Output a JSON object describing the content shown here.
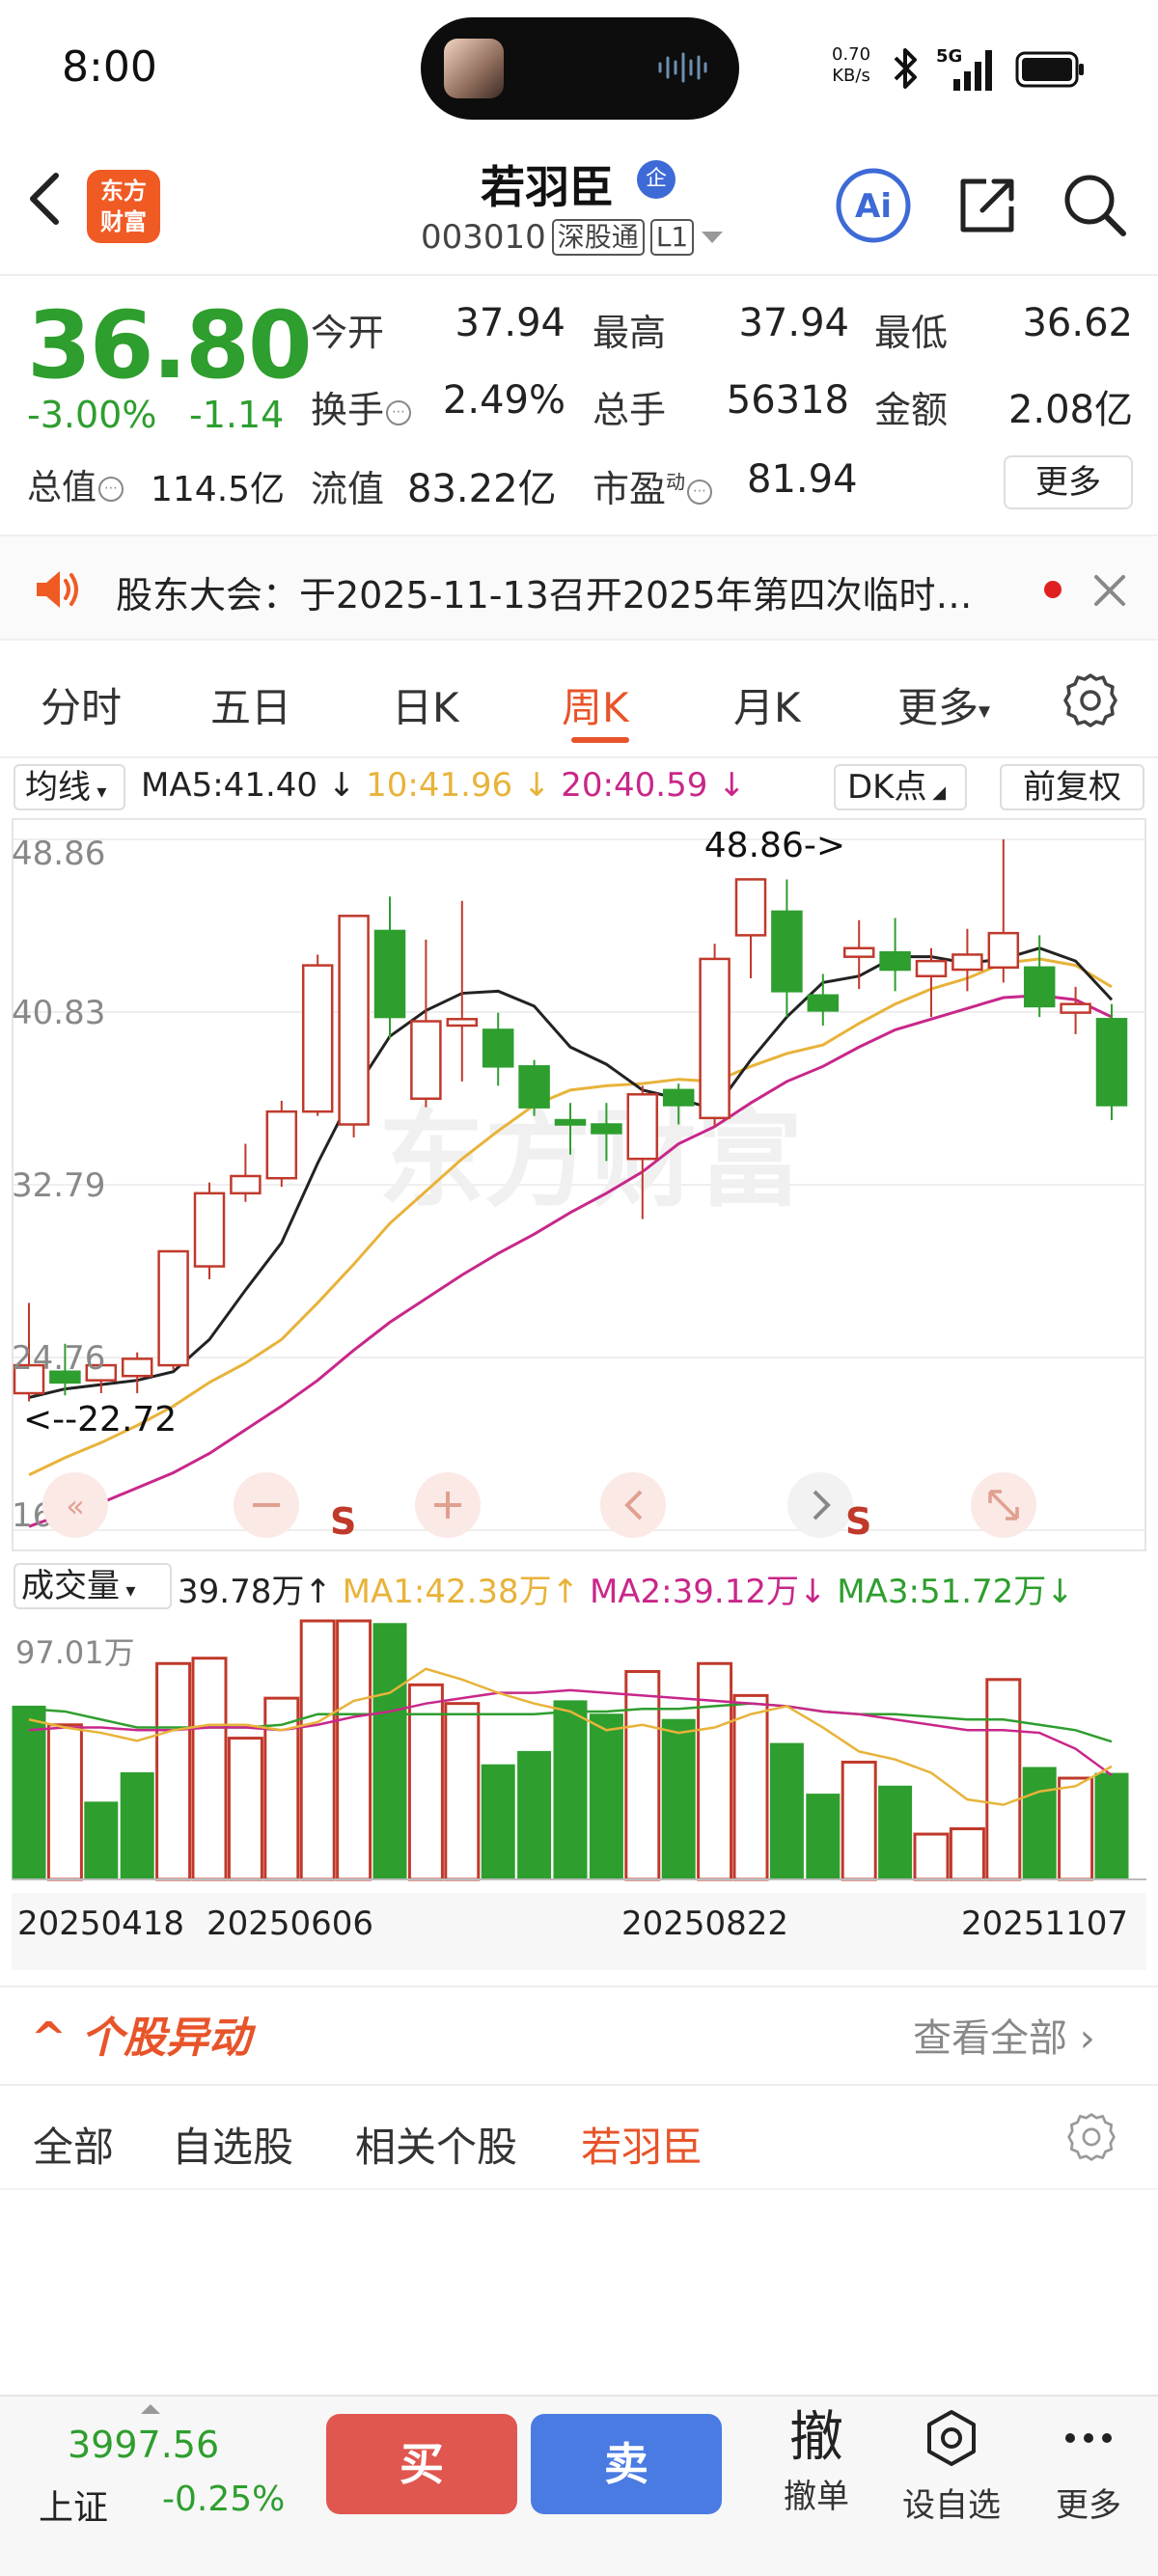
{
  "status_bar": {
    "time": "8:00",
    "net_speed_value": "0.70",
    "net_speed_unit": "KB/s",
    "network": "5G"
  },
  "header": {
    "logo_line1": "东方",
    "logo_line2": "财富",
    "stock_name": "若羽臣",
    "badge": "企",
    "code": "003010",
    "tag1": "深股通",
    "tag2": "L1"
  },
  "quote": {
    "price": "36.80",
    "change_pct": "-3.00%",
    "change_amt": "-1.14",
    "rows": [
      [
        {
          "label": "今开",
          "value": "37.94"
        },
        {
          "label": "最高",
          "value": "37.94"
        },
        {
          "label": "最低",
          "value": "36.62"
        }
      ],
      [
        {
          "label": "换手",
          "value": "2.49%"
        },
        {
          "label": "总手",
          "value": "56318"
        },
        {
          "label": "金额",
          "value": "2.08亿"
        }
      ]
    ],
    "total_mv_label": "总值",
    "total_mv": "114.5亿",
    "float_mv_label": "流值",
    "float_mv": "83.22亿",
    "pe_label": "市盈",
    "pe_sup": "动",
    "pe": "81.94",
    "more": "更多"
  },
  "notice": {
    "text": "股东大会：于2025-11-13召开2025年第四次临时…"
  },
  "tabs": {
    "items": [
      "分时",
      "五日",
      "日K",
      "周K",
      "月K",
      "更多"
    ],
    "active": "周K"
  },
  "kline_legend": {
    "dropdown": "均线",
    "ma5": "MA5:41.40",
    "ma10": "10:41.96",
    "ma20": "20:40.59",
    "dk": "DK点",
    "adjust": "前复权",
    "colors": {
      "ma5": "#222222",
      "ma10": "#e8b33a",
      "ma20": "#c8278a",
      "up": "#c0392b",
      "down": "#2e9e2e"
    }
  },
  "volume_legend": {
    "dropdown": "成交量",
    "vol": "39.78万",
    "ma1": "MA1:42.38万",
    "ma2": "MA2:39.12万",
    "ma3": "MA3:51.72万"
  },
  "chart_data": [
    {
      "type": "candlestick",
      "period": "weekly",
      "y_ticks": [
        "48.86",
        "40.83",
        "32.79",
        "24.76",
        "16.73"
      ],
      "ylim": [
        16.73,
        48.86
      ],
      "annotations": {
        "max_label": "48.86->",
        "min_label": "<--22.72"
      },
      "markers": [
        "S",
        "S"
      ],
      "watermark": "东方财富",
      "candles": [
        {
          "o": 23.1,
          "h": 27.3,
          "l": 22.72,
          "c": 24.4
        },
        {
          "o": 24.1,
          "h": 25.4,
          "l": 23.0,
          "c": 23.6
        },
        {
          "o": 23.7,
          "h": 24.6,
          "l": 23.1,
          "c": 24.4
        },
        {
          "o": 23.9,
          "h": 25.0,
          "l": 23.1,
          "c": 24.7
        },
        {
          "o": 24.4,
          "h": 29.7,
          "l": 24.2,
          "c": 29.7
        },
        {
          "o": 29.0,
          "h": 32.9,
          "l": 28.4,
          "c": 32.4
        },
        {
          "o": 32.4,
          "h": 34.7,
          "l": 32.0,
          "c": 33.2
        },
        {
          "o": 33.1,
          "h": 36.7,
          "l": 32.7,
          "c": 36.2
        },
        {
          "o": 36.2,
          "h": 43.5,
          "l": 36.0,
          "c": 43.0
        },
        {
          "o": 35.6,
          "h": 45.3,
          "l": 35.0,
          "c": 45.3
        },
        {
          "o": 44.6,
          "h": 46.2,
          "l": 39.6,
          "c": 40.6
        },
        {
          "o": 36.8,
          "h": 44.2,
          "l": 36.4,
          "c": 40.4
        },
        {
          "o": 40.2,
          "h": 46.0,
          "l": 37.6,
          "c": 40.5
        },
        {
          "o": 40.0,
          "h": 40.8,
          "l": 37.4,
          "c": 38.3
        },
        {
          "o": 38.3,
          "h": 38.6,
          "l": 36.0,
          "c": 36.4
        },
        {
          "o": 35.8,
          "h": 36.6,
          "l": 34.2,
          "c": 35.6
        },
        {
          "o": 35.6,
          "h": 36.6,
          "l": 33.9,
          "c": 35.2
        },
        {
          "o": 34.0,
          "h": 37.4,
          "l": 31.2,
          "c": 37.0
        },
        {
          "o": 37.2,
          "h": 37.5,
          "l": 35.6,
          "c": 36.5
        },
        {
          "o": 35.9,
          "h": 44.0,
          "l": 35.5,
          "c": 43.3
        },
        {
          "o": 44.4,
          "h": 46.9,
          "l": 42.4,
          "c": 47.0
        },
        {
          "o": 45.5,
          "h": 47.0,
          "l": 40.6,
          "c": 41.8
        },
        {
          "o": 41.6,
          "h": 42.6,
          "l": 40.2,
          "c": 40.9
        },
        {
          "o": 43.4,
          "h": 45.1,
          "l": 41.9,
          "c": 43.8
        },
        {
          "o": 43.6,
          "h": 45.2,
          "l": 41.8,
          "c": 42.8
        },
        {
          "o": 42.5,
          "h": 43.8,
          "l": 40.6,
          "c": 43.2
        },
        {
          "o": 42.8,
          "h": 44.7,
          "l": 41.8,
          "c": 43.5
        },
        {
          "o": 42.9,
          "h": 48.86,
          "l": 42.2,
          "c": 44.5
        },
        {
          "o": 42.9,
          "h": 44.4,
          "l": 40.6,
          "c": 41.1
        },
        {
          "o": 40.8,
          "h": 42.0,
          "l": 39.8,
          "c": 41.2
        },
        {
          "o": 40.5,
          "h": 41.2,
          "l": 35.8,
          "c": 36.5
        }
      ],
      "ma5": [
        22.9,
        23.3,
        23.5,
        23.7,
        24.1,
        25.6,
        27.9,
        30.1,
        33.8,
        37.1,
        39.7,
        40.9,
        41.7,
        41.8,
        41.1,
        39.2,
        38.4,
        37.2,
        36.8,
        36.3,
        38.6,
        40.6,
        42.2,
        42.5,
        43.4,
        43.4,
        43.1,
        43.3,
        43.8,
        43.2,
        41.4
      ],
      "ma10": [
        19.3,
        20.1,
        20.8,
        21.6,
        22.5,
        23.6,
        24.5,
        25.6,
        27.3,
        29.1,
        31.0,
        32.5,
        34.0,
        35.3,
        36.5,
        37.2,
        37.4,
        37.5,
        37.7,
        37.6,
        38.3,
        38.9,
        39.3,
        40.3,
        41.2,
        41.9,
        42.4,
        43.1,
        43.3,
        43.0,
        42.0
      ],
      "ma20": [
        16.9,
        17.5,
        18.0,
        18.7,
        19.4,
        20.3,
        21.4,
        22.5,
        23.7,
        25.1,
        26.4,
        27.5,
        28.6,
        29.6,
        30.5,
        31.5,
        32.4,
        33.4,
        34.7,
        35.5,
        36.6,
        37.6,
        38.3,
        39.2,
        40.0,
        40.5,
        41.0,
        41.5,
        41.6,
        41.4,
        40.6
      ]
    },
    {
      "type": "bar",
      "title": "成交量",
      "y_ticks": [
        "97.01万"
      ],
      "ylim": [
        0,
        97.01
      ],
      "up": [
        false,
        true,
        false,
        false,
        true,
        true,
        true,
        true,
        true,
        true,
        false,
        true,
        true,
        false,
        false,
        false,
        false,
        true,
        false,
        true,
        true,
        false,
        false,
        true,
        false,
        true,
        true,
        true,
        false,
        true,
        false
      ],
      "values": [
        65,
        58,
        29,
        40,
        81,
        83,
        53,
        68,
        97,
        97,
        96,
        73,
        66,
        43,
        48,
        67,
        62,
        78,
        60,
        81,
        69,
        51,
        32,
        44,
        35,
        17,
        19,
        75,
        42,
        38,
        39.78
      ],
      "ma1": [
        60,
        57,
        55,
        52,
        56,
        58,
        58,
        56,
        59,
        67,
        70,
        79,
        75,
        70,
        66,
        63,
        56,
        58,
        55,
        57,
        62,
        65,
        57,
        48,
        45,
        40,
        30,
        28,
        33,
        35,
        42.4
      ],
      "ma2": [
        56,
        57,
        57,
        56,
        56,
        57,
        57,
        56,
        58,
        61,
        63,
        66,
        68,
        70,
        70,
        71,
        70,
        69,
        68,
        67,
        66,
        65,
        63,
        62,
        60,
        58,
        56,
        56,
        55,
        49,
        39.1
      ],
      "ma3": [
        64,
        63,
        60,
        57,
        57,
        57,
        57,
        58,
        62,
        62,
        62,
        62,
        62,
        62,
        62,
        63,
        63,
        64,
        64,
        65,
        66,
        65,
        63,
        62,
        62,
        61,
        60,
        60,
        58,
        56,
        51.7
      ],
      "x_labels": [
        "20250418",
        "20250606",
        "20250822",
        "20251107"
      ]
    }
  ],
  "section": {
    "title": "个股异动",
    "view_all": "查看全部",
    "subtabs": [
      "全部",
      "自选股",
      "相关个股",
      "若羽臣"
    ],
    "active_subtab": "若羽臣"
  },
  "bottom": {
    "index_value": "3997.56",
    "index_name": "上证",
    "index_change": "-0.25%",
    "buy": "买",
    "sell": "卖",
    "cancel_icon_char": "撤",
    "cancel_label": "撤单",
    "watch_label": "设自选",
    "more_label": "更多"
  }
}
